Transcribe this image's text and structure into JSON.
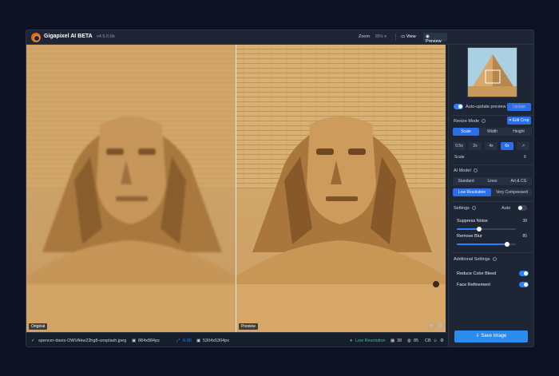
{
  "app": {
    "name": "Gigapixel AI BETA",
    "version": "v4.5.0.0b"
  },
  "toolbar": {
    "zoom_label": "Zoom",
    "zoom_value": "85%",
    "view_label": "View",
    "preview_label": "Preview"
  },
  "panes": {
    "left_tag": "Original",
    "right_tag": "Preview"
  },
  "status": {
    "filename": "spencer-davis-OWVAkw23hg8-unsplash.jpeg",
    "orig_size": "884x884px",
    "scale": "6.00",
    "out_size": "5304x5304px",
    "mode": "Low Resolution",
    "noise": "38",
    "blur": "85"
  },
  "sidebar": {
    "auto_update_label": "Auto-update preview",
    "update_label": "Update",
    "resize_mode_label": "Resize Mode",
    "edit_crop_label": "Edit Crop",
    "resize_tabs": [
      "Scale",
      "Width",
      "Height"
    ],
    "scale_options": [
      "0.5x",
      "2x",
      "4x",
      "6x",
      "↗"
    ],
    "scale_label": "Scale",
    "scale_value": "6",
    "ai_model_label": "AI Model",
    "models": [
      "Standard",
      "Lines",
      "Art & CG"
    ],
    "models2": [
      "Low Resolution",
      "Very Compressed"
    ],
    "settings_label": "Settings",
    "auto_label": "Auto",
    "suppress_label": "Suppress Noise",
    "suppress_value": "38",
    "blur_label": "Remove Blur",
    "blur_value": "85",
    "additional_label": "Additional Settings",
    "reduce_color_label": "Reduce Color Bleed",
    "face_label": "Face Refinement",
    "save_label": "Save Image"
  },
  "colors": {
    "accent": "#2b80ff",
    "background": "#0d1224",
    "panel": "#1e2636"
  }
}
